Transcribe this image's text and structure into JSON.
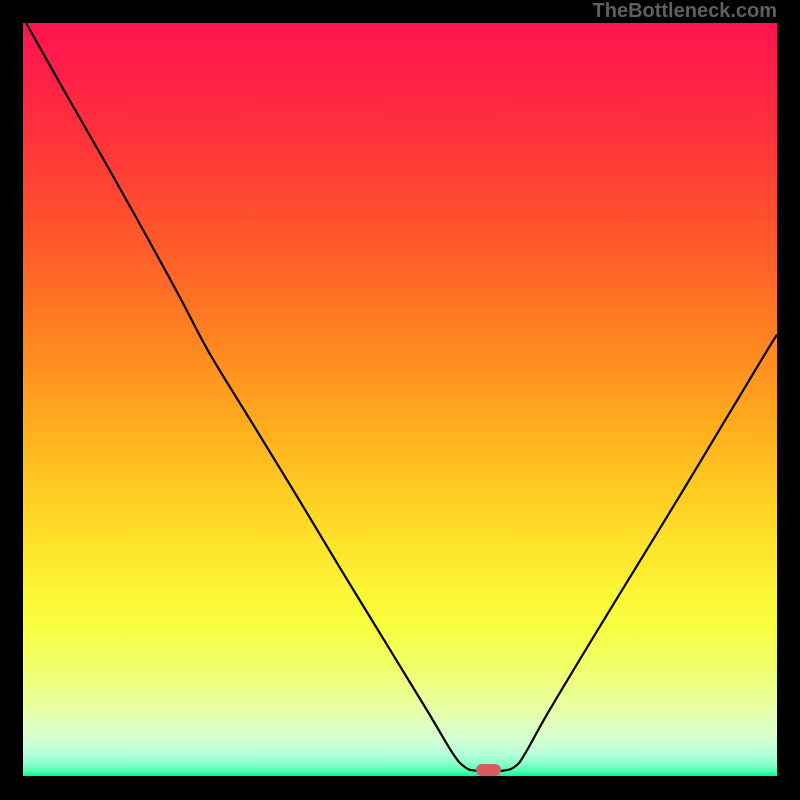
{
  "watermark": "TheBottleneck.com",
  "marker": {
    "x_frac": 0.617,
    "y_frac": 0.992,
    "color": "#d95a5a"
  },
  "gradient_stops": [
    {
      "offset": 0.0,
      "color": "#ff1350"
    },
    {
      "offset": 0.048,
      "color": "#ff1c4a"
    },
    {
      "offset": 0.099,
      "color": "#ff2742"
    },
    {
      "offset": 0.149,
      "color": "#ff323b"
    },
    {
      "offset": 0.2,
      "color": "#ff3f35"
    },
    {
      "offset": 0.249,
      "color": "#ff4d2f"
    },
    {
      "offset": 0.3,
      "color": "#ff5c2a"
    },
    {
      "offset": 0.35,
      "color": "#ff6c25"
    },
    {
      "offset": 0.399,
      "color": "#ff7c22"
    },
    {
      "offset": 0.45,
      "color": "#ff8e1f"
    },
    {
      "offset": 0.5,
      "color": "#ffa01e"
    },
    {
      "offset": 0.549,
      "color": "#ffb21e"
    },
    {
      "offset": 0.6,
      "color": "#ffc421"
    },
    {
      "offset": 0.65,
      "color": "#ffd525"
    },
    {
      "offset": 0.699,
      "color": "#fee52c"
    },
    {
      "offset": 0.75,
      "color": "#fcf335"
    },
    {
      "offset": 0.8,
      "color": "#f8ff3f"
    },
    {
      "offset": 0.849,
      "color": "#f1ff66"
    },
    {
      "offset": 0.867,
      "color": "#efff78"
    },
    {
      "offset": 0.885,
      "color": "#ecff8a"
    },
    {
      "offset": 0.9,
      "color": "#e9ff99"
    },
    {
      "offset": 0.915,
      "color": "#e5ffaa"
    },
    {
      "offset": 0.929,
      "color": "#e0ffba"
    },
    {
      "offset": 0.941,
      "color": "#daffc7"
    },
    {
      "offset": 0.95,
      "color": "#d4ffd1"
    },
    {
      "offset": 0.96,
      "color": "#c6ffd7"
    },
    {
      "offset": 0.969,
      "color": "#b7ffd8"
    },
    {
      "offset": 0.975,
      "color": "#a6ffd5"
    },
    {
      "offset": 0.981,
      "color": "#93ffd0"
    },
    {
      "offset": 0.986,
      "color": "#7fffc8"
    },
    {
      "offset": 0.989,
      "color": "#68ffbe"
    },
    {
      "offset": 0.993,
      "color": "#4effb1"
    },
    {
      "offset": 0.996,
      "color": "#30ffa2"
    },
    {
      "offset": 1.0,
      "color": "#00ff8f"
    }
  ],
  "chart_data": {
    "type": "line",
    "title": "",
    "xlabel": "",
    "ylabel": "",
    "xlim": [
      0,
      1
    ],
    "ylim": [
      0,
      1
    ],
    "series": [
      {
        "name": "bottleneck-curve",
        "points": [
          {
            "x": 0.004,
            "y": 1.0
          },
          {
            "x": 0.058,
            "y": 0.904
          },
          {
            "x": 0.113,
            "y": 0.808
          },
          {
            "x": 0.166,
            "y": 0.713
          },
          {
            "x": 0.209,
            "y": 0.634
          },
          {
            "x": 0.247,
            "y": 0.562
          },
          {
            "x": 0.305,
            "y": 0.467
          },
          {
            "x": 0.363,
            "y": 0.372
          },
          {
            "x": 0.42,
            "y": 0.277
          },
          {
            "x": 0.478,
            "y": 0.182
          },
          {
            "x": 0.536,
            "y": 0.087
          },
          {
            "x": 0.57,
            "y": 0.03
          },
          {
            "x": 0.586,
            "y": 0.012
          },
          {
            "x": 0.601,
            "y": 0.007
          },
          {
            "x": 0.636,
            "y": 0.007
          },
          {
            "x": 0.653,
            "y": 0.013
          },
          {
            "x": 0.666,
            "y": 0.03
          },
          {
            "x": 0.698,
            "y": 0.087
          },
          {
            "x": 0.755,
            "y": 0.182
          },
          {
            "x": 0.813,
            "y": 0.277
          },
          {
            "x": 0.871,
            "y": 0.372
          },
          {
            "x": 0.928,
            "y": 0.467
          },
          {
            "x": 0.985,
            "y": 0.562
          },
          {
            "x": 1.0,
            "y": 0.586
          }
        ]
      }
    ]
  }
}
